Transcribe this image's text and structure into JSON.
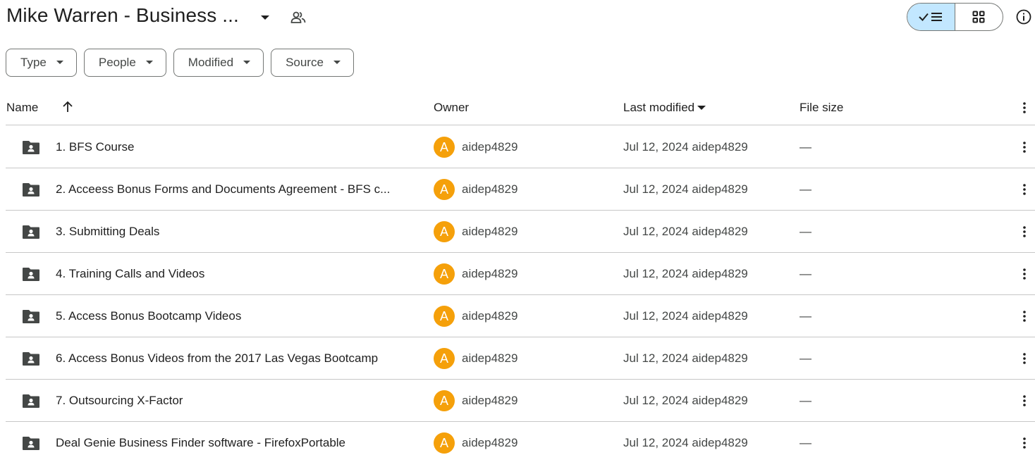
{
  "header": {
    "title": "Mike Warren - Business ...",
    "shared_icon": "people-icon",
    "view_list_icon": "check-list-icon",
    "view_grid_icon": "grid-icon",
    "info_icon": "info-icon"
  },
  "filters": [
    {
      "label": "Type"
    },
    {
      "label": "People"
    },
    {
      "label": "Modified"
    },
    {
      "label": "Source"
    }
  ],
  "columns": {
    "name": "Name",
    "owner": "Owner",
    "last_modified": "Last modified",
    "file_size": "File size"
  },
  "rows": [
    {
      "name": "1. BFS Course",
      "owner_initial": "A",
      "owner": "aidep4829",
      "modified": "Jul 12, 2024 aidep4829",
      "size": "—"
    },
    {
      "name": "2. Acceess Bonus Forms and Documents Agreement - BFS c...",
      "owner_initial": "A",
      "owner": "aidep4829",
      "modified": "Jul 12, 2024 aidep4829",
      "size": "—"
    },
    {
      "name": "3. Submitting Deals",
      "owner_initial": "A",
      "owner": "aidep4829",
      "modified": "Jul 12, 2024 aidep4829",
      "size": "—"
    },
    {
      "name": "4. Training Calls and Videos",
      "owner_initial": "A",
      "owner": "aidep4829",
      "modified": "Jul 12, 2024 aidep4829",
      "size": "—"
    },
    {
      "name": "5. Access Bonus Bootcamp Videos",
      "owner_initial": "A",
      "owner": "aidep4829",
      "modified": "Jul 12, 2024 aidep4829",
      "size": "—"
    },
    {
      "name": "6. Access Bonus Videos from the 2017 Las Vegas Bootcamp",
      "owner_initial": "A",
      "owner": "aidep4829",
      "modified": "Jul 12, 2024 aidep4829",
      "size": "—"
    },
    {
      "name": "7. Outsourcing X-Factor",
      "owner_initial": "A",
      "owner": "aidep4829",
      "modified": "Jul 12, 2024 aidep4829",
      "size": "—"
    },
    {
      "name": "Deal Genie Business Finder software - FirefoxPortable",
      "owner_initial": "A",
      "owner": "aidep4829",
      "modified": "Jul 12, 2024 aidep4829",
      "size": "—"
    }
  ],
  "colors": {
    "avatar": "#f5a00a",
    "view_toggle_active": "#c2e7ff"
  }
}
